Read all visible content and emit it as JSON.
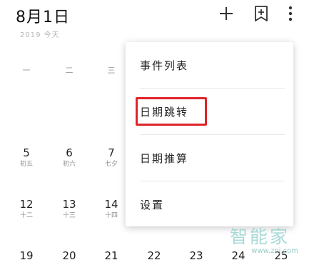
{
  "header": {
    "title": "8月1日",
    "subtitle": "2019 今天"
  },
  "toolbar": {
    "add_icon": "plus-icon",
    "bookmark_icon": "bookmark-plus-icon",
    "more_icon": "more-vert-icon"
  },
  "weekdays": [
    "一",
    "二",
    "三"
  ],
  "calendar": {
    "row1": [
      {
        "num": "5",
        "lunar": "初五"
      },
      {
        "num": "6",
        "lunar": "初六"
      },
      {
        "num": "7",
        "lunar": "七夕"
      }
    ],
    "row2": [
      {
        "num": "12",
        "lunar": "十二"
      },
      {
        "num": "13",
        "lunar": "十三"
      },
      {
        "num": "14",
        "lunar": "十四"
      }
    ],
    "row3": [
      "19",
      "20",
      "21",
      "22",
      "23",
      "24",
      "25"
    ]
  },
  "menu": {
    "items": [
      "事件列表",
      "日期跳转",
      "日期推算",
      "设置"
    ],
    "highlighted_item": "日期跳转",
    "highlight_color": "#e0242a"
  },
  "watermark": {
    "brand": "智能家",
    "url": "www.znj.com"
  }
}
